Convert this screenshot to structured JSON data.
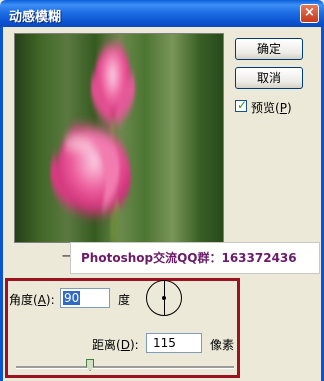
{
  "window": {
    "title": "动感模糊",
    "close_glyph": "×"
  },
  "buttons": {
    "ok": "确定",
    "cancel": "取消"
  },
  "preview_option": {
    "label_prefix": "预览(",
    "hotkey": "P",
    "label_suffix": ")",
    "checked": true
  },
  "zoom": {
    "minus": "一"
  },
  "watermark": {
    "text": "Photoshop交流QQ群：163372436"
  },
  "angle": {
    "label_prefix": "角度(",
    "hotkey": "A",
    "label_suffix": "):",
    "value": "90",
    "unit": "度"
  },
  "distance": {
    "label_prefix": "距离(",
    "hotkey": "D",
    "label_suffix": "):",
    "value": "115",
    "unit": "像素",
    "slider_fraction": 0.34
  },
  "colors": {
    "highlight_border": "#9e1220",
    "titlebar": "#0b54d1",
    "watermark_text": "#6a1b6a"
  }
}
